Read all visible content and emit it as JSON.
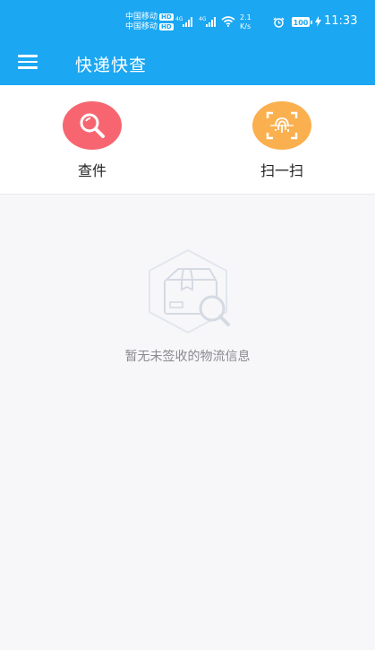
{
  "status_bar": {
    "carrier_1": "中国移动",
    "carrier_2": "中国移动",
    "hd_badge": "HD",
    "network_1": "4G",
    "network_2": "4G",
    "speed_value": "2.1",
    "speed_unit": "K/s",
    "battery": "100",
    "time": "11:33",
    "icons": [
      "signal-icon",
      "wifi-icon",
      "alarm-icon",
      "battery-icon",
      "charging-icon"
    ]
  },
  "app_bar": {
    "title": "快递快查",
    "menu_icon": "menu-icon"
  },
  "actions": [
    {
      "label": "查件",
      "icon": "search-icon",
      "color": "#f76670"
    },
    {
      "label": "扫一扫",
      "icon": "scan-icon",
      "color": "#fbb04f"
    }
  ],
  "empty_state": {
    "message": "暂无未签收的物流信息",
    "icon": "package-search-icon"
  },
  "colors": {
    "primary": "#1ba7f2",
    "search_accent": "#f76670",
    "scan_accent": "#fbb04f",
    "background": "#f7f7f9",
    "muted_text": "#8a8a8f"
  }
}
